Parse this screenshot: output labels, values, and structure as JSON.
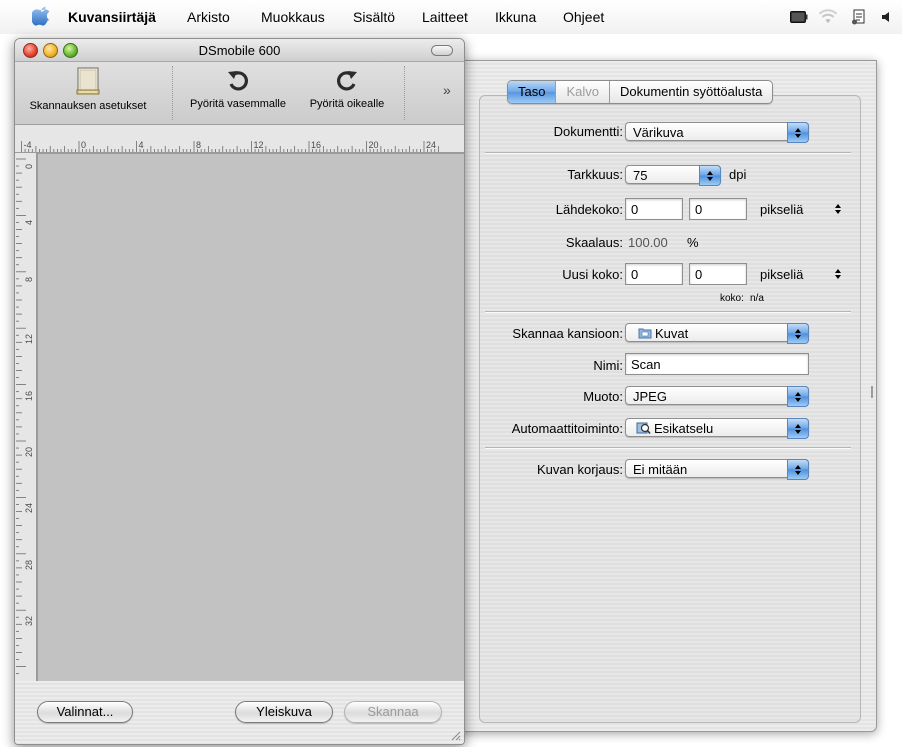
{
  "menubar": {
    "app_name": "Kuvansiirtäjä",
    "items": [
      "Arkisto",
      "Muokkaus",
      "Sisältö",
      "Laitteet",
      "Ikkuna",
      "Ohjeet"
    ]
  },
  "scan_window": {
    "title": "DSmobile 600",
    "toolbar": {
      "scan_settings": "Skannauksen asetukset",
      "rotate_left": "Pyöritä vasemmalle",
      "rotate_right": "Pyöritä oikealle",
      "overflow": "»"
    },
    "ruler_h": [
      "-4",
      "0",
      "4",
      "8",
      "12",
      "16",
      "20",
      "24"
    ],
    "ruler_v": [
      "0",
      "4",
      "8",
      "12",
      "16",
      "20",
      "24",
      "28",
      "32"
    ],
    "buttons": {
      "options": "Valinnat...",
      "overview": "Yleiskuva",
      "scan": "Skannaa"
    }
  },
  "settings": {
    "tabs": [
      {
        "label": "Taso",
        "state": "active"
      },
      {
        "label": "Kalvo",
        "state": "disabled"
      },
      {
        "label": "Dokumentin syöttöalusta",
        "state": "normal"
      }
    ],
    "document_label": "Dokumentti:",
    "document_value": "Värikuva",
    "resolution_label": "Tarkkuus:",
    "resolution_value": "75",
    "resolution_unit": "dpi",
    "source_size_label": "Lähdekoko:",
    "source_w": "0",
    "source_h": "0",
    "source_unit": "pikseliä",
    "scale_label": "Skaalaus:",
    "scale_value": "100.00",
    "scale_unit": "%",
    "new_size_label": "Uusi koko:",
    "new_w": "0",
    "new_h": "0",
    "new_unit": "pikseliä",
    "size_info_label": "koko:",
    "size_info_value": "n/a",
    "scan_to_label": "Skannaa kansioon:",
    "scan_to_value": "Kuvat",
    "name_label": "Nimi:",
    "name_value": "Scan",
    "format_label": "Muoto:",
    "format_value": "JPEG",
    "auto_label": "Automaattitoiminto:",
    "auto_value": "Esikatselu",
    "correction_label": "Kuvan korjaus:",
    "correction_value": "Ei mitään"
  }
}
